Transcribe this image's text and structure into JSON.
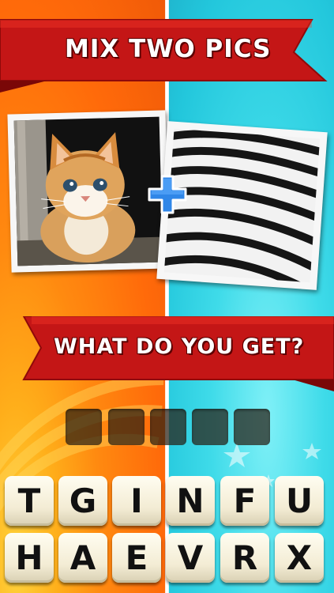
{
  "header": {
    "title": "MIX TWO PICS"
  },
  "pictures": {
    "left": {
      "icon": "kitten-photo"
    },
    "plus": {
      "icon": "plus-icon",
      "color": "#2f86e8"
    },
    "right": {
      "icon": "black-white-stripes-photo"
    }
  },
  "prompt": {
    "text": "WHAT DO YOU GET?"
  },
  "answer": {
    "slot_count": 5
  },
  "letters": {
    "row1": [
      "T",
      "G",
      "I",
      "N",
      "F",
      "U"
    ],
    "row2": [
      "H",
      "A",
      "E",
      "V",
      "R",
      "X"
    ]
  },
  "colors": {
    "banner": "#d71f1f",
    "left_bg": "#ff7a0c",
    "right_bg": "#33d2e3"
  }
}
